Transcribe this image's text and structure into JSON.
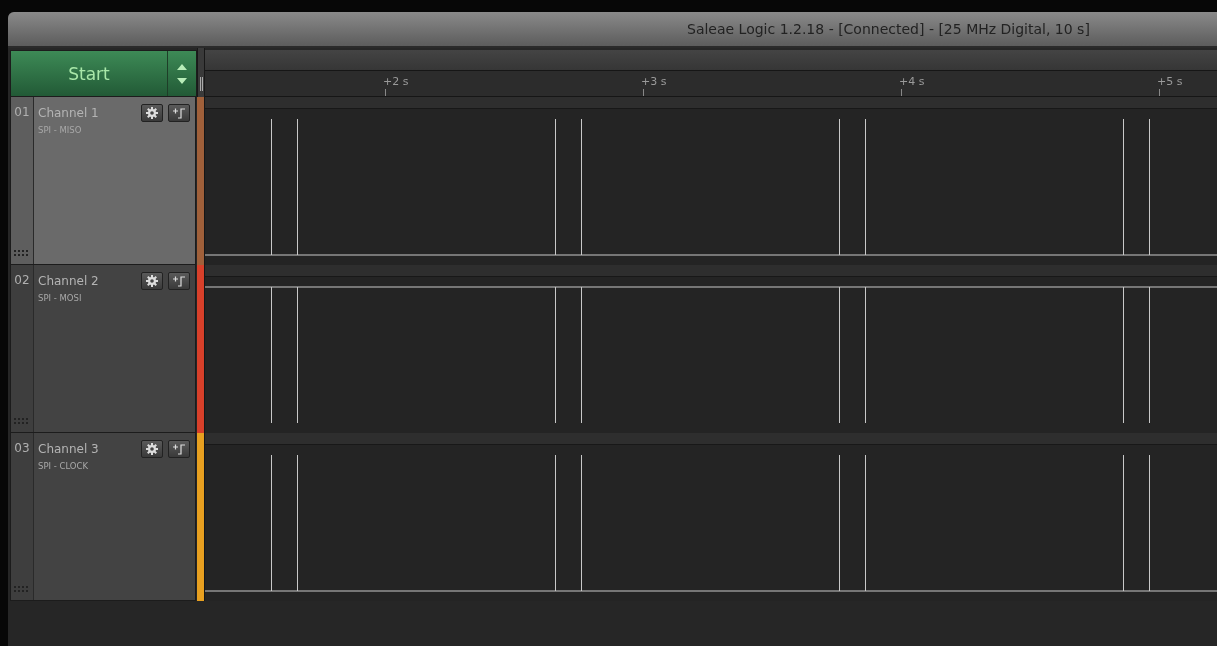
{
  "window": {
    "title": "Saleae Logic 1.2.18 - [Connected] - [25 MHz Digital, 10 s]"
  },
  "start_button": {
    "label": "Start"
  },
  "timeline": {
    "ticks": [
      "+2 s",
      "+3 s",
      "+4 s",
      "+5 s"
    ]
  },
  "channels": [
    {
      "number": "01",
      "name": "Channel 1",
      "protocol": "SPI - MISO",
      "color": "#a0603a",
      "selected": true,
      "idle_high": false
    },
    {
      "number": "02",
      "name": "Channel 2",
      "protocol": "SPI - MOSI",
      "color": "#d8402a",
      "selected": false,
      "idle_high": true
    },
    {
      "number": "03",
      "name": "Channel 3",
      "protocol": "SPI - CLOCK",
      "color": "#e8a020",
      "selected": false,
      "idle_high": false
    }
  ]
}
